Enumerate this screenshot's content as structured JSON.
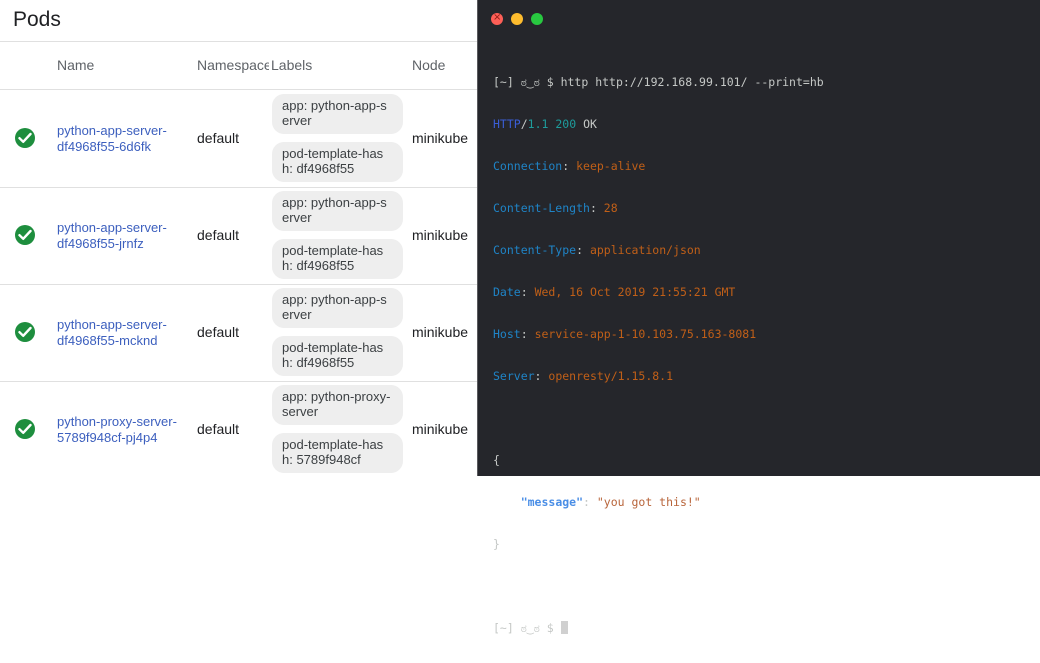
{
  "pods": {
    "title": "Pods",
    "columns": {
      "name": "Name",
      "namespace": "Namespace",
      "labels": "Labels",
      "node": "Node"
    },
    "rows": [
      {
        "status": "running",
        "name": "python-app-server-df4968f55-6d6fk",
        "namespace": "default",
        "labels": [
          "app: python-app-server",
          "pod-template-hash: df4968f55"
        ],
        "node": "minikube"
      },
      {
        "status": "running",
        "name": "python-app-server-df4968f55-jrnfz",
        "namespace": "default",
        "labels": [
          "app: python-app-server",
          "pod-template-hash: df4968f55"
        ],
        "node": "minikube"
      },
      {
        "status": "running",
        "name": "python-app-server-df4968f55-mcknd",
        "namespace": "default",
        "labels": [
          "app: python-app-server",
          "pod-template-hash: df4968f55"
        ],
        "node": "minikube"
      },
      {
        "status": "running",
        "name": "python-proxy-server-5789f948cf-pj4p4",
        "namespace": "default",
        "labels": [
          "app: python-proxy-server",
          "pod-template-hash: 5789f948cf"
        ],
        "node": "minikube"
      }
    ]
  },
  "terminal": {
    "prompt": "[~] ಠ‿ಠ $",
    "command": "http http://192.168.99.101/ --print=hb",
    "status": {
      "proto": "HTTP",
      "slash": "/",
      "version": "1.1",
      "code": "200",
      "reason": "OK"
    },
    "headers": [
      {
        "key": "Connection",
        "value": "keep-alive"
      },
      {
        "key": "Content-Length",
        "value": "28"
      },
      {
        "key": "Content-Type",
        "value": "application/json"
      },
      {
        "key": "Date",
        "value": "Wed, 16 Oct 2019 21:55:21 GMT"
      },
      {
        "key": "Host",
        "value": "service-app-1-10.103.75.163-8081"
      },
      {
        "key": "Server",
        "value": "openresty/1.15.8.1"
      }
    ],
    "body": {
      "open": "{",
      "key": "\"message\"",
      "value": "\"you got this!\"",
      "close": "}"
    },
    "prompt2": "[~] ಠ‿ಠ $"
  },
  "colors": {
    "link": "#3c5fbe",
    "status_ok": "#1e8e3e",
    "terminal_bg": "#25262b",
    "header_key": "#1f84c7",
    "header_value": "#c05f18"
  },
  "icons": {
    "status": "check-circle-icon"
  }
}
